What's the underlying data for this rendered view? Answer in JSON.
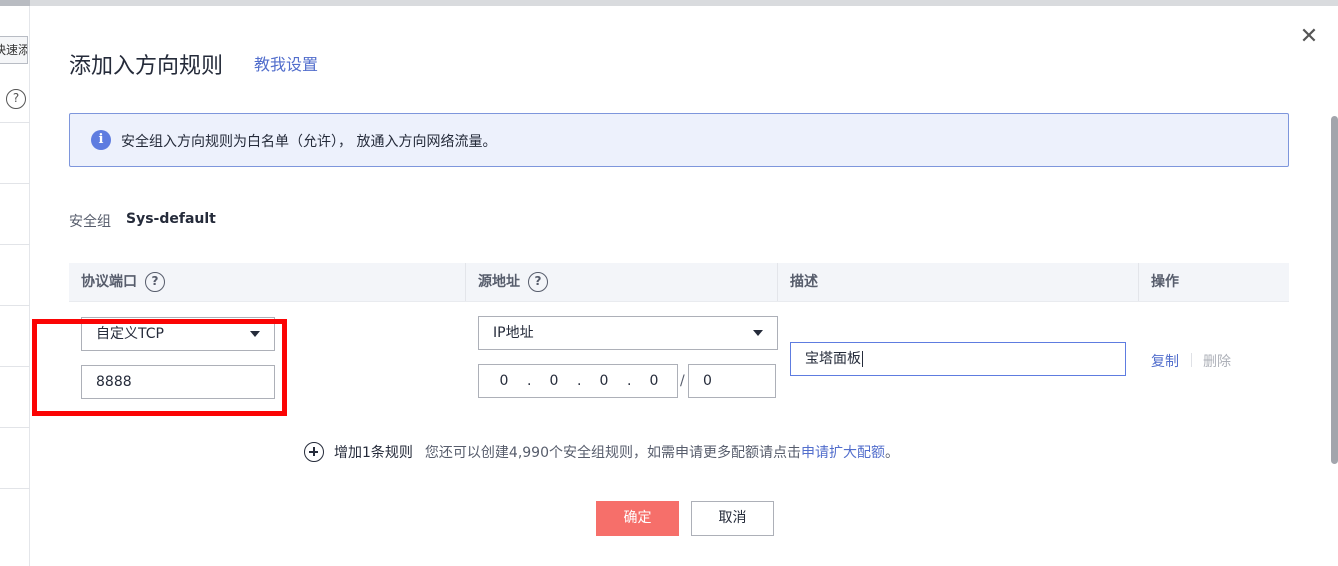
{
  "background": {
    "quick_button_label": "快速添"
  },
  "modal": {
    "title": "添加入方向规则",
    "help_link": "教我设置",
    "close_icon": "close-icon",
    "info_text": "安全组入方向规则为白名单（允许）， 放通入方向网络流量。",
    "security_group_label": "安全组",
    "security_group_value": "Sys-default",
    "columns": {
      "protocol_port": "协议端口",
      "source": "源地址",
      "description": "描述",
      "actions": "操作"
    },
    "rule": {
      "protocol": "自定义TCP",
      "port": "8888",
      "source_type": "IP地址",
      "ip_octets": [
        "0",
        "0",
        "0",
        "0"
      ],
      "mask": "0",
      "description": "宝塔面板",
      "copy": "复制",
      "delete": "删除"
    },
    "add_rule": {
      "label": "增加1条规则",
      "note": "您还可以创建4,990个安全组规则，如需申请更多配额请点击",
      "link": "申请扩大配额",
      "end": "。"
    },
    "buttons": {
      "ok": "确定",
      "cancel": "取消"
    }
  },
  "colors": {
    "accent": "#526ecc",
    "primary_button": "#f66f6a",
    "highlight": "#fb0404",
    "info_bg": "#edf1fc"
  }
}
